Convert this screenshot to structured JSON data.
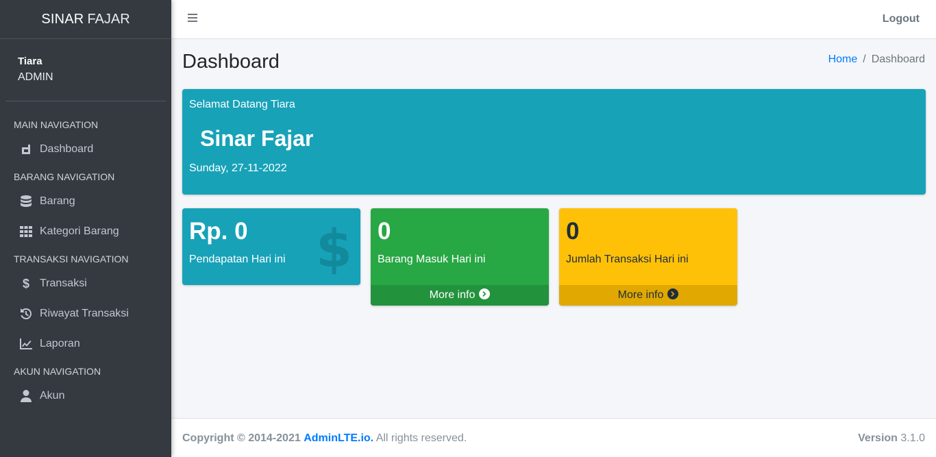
{
  "brand": {
    "part1": "SINAR",
    "part2": "FAJAR"
  },
  "user": {
    "name": "Tiara",
    "role": "ADMIN"
  },
  "nav": {
    "headers": [
      "MAIN NAVIGATION",
      "BARANG NAVIGATION",
      "TRANSAKSI NAVIGATION",
      "AKUN NAVIGATION"
    ],
    "items": [
      {
        "label": "Dashboard",
        "icon": "dashboard-icon"
      },
      {
        "label": "Barang",
        "icon": "database-icon"
      },
      {
        "label": "Kategori Barang",
        "icon": "grid-icon"
      },
      {
        "label": "Transaksi",
        "icon": "dollar-icon"
      },
      {
        "label": "Riwayat Transaksi",
        "icon": "history-icon"
      },
      {
        "label": "Laporan",
        "icon": "chart-line-icon"
      },
      {
        "label": "Akun",
        "icon": "user-icon"
      }
    ]
  },
  "topbar": {
    "logout": "Logout"
  },
  "page": {
    "title": "Dashboard",
    "breadcrumb": {
      "home": "Home",
      "separator": "/",
      "current": "Dashboard"
    }
  },
  "welcome": {
    "greeting": "Selamat Datang Tiara",
    "title": "Sinar Fajar",
    "date": "Sunday, 27-11-2022",
    "color": "#17a2b8"
  },
  "boxes": [
    {
      "value": "Rp. 0",
      "label": "Pendapatan Hari ini",
      "color": "#17a2b8",
      "icon": "dollar-sign-icon",
      "icon_glyph": "$"
    },
    {
      "value": "0",
      "label": "Barang Masuk Hari ini",
      "color": "#28a745",
      "more": "More info"
    },
    {
      "value": "0",
      "label": "Jumlah Transaksi Hari ini",
      "color": "#ffc107",
      "more": "More info"
    }
  ],
  "footer": {
    "copyright": "Copyright © 2014-2021",
    "link": "AdminLTE.io.",
    "rights": "All rights reserved.",
    "version_label": "Version",
    "version": "3.1.0"
  }
}
